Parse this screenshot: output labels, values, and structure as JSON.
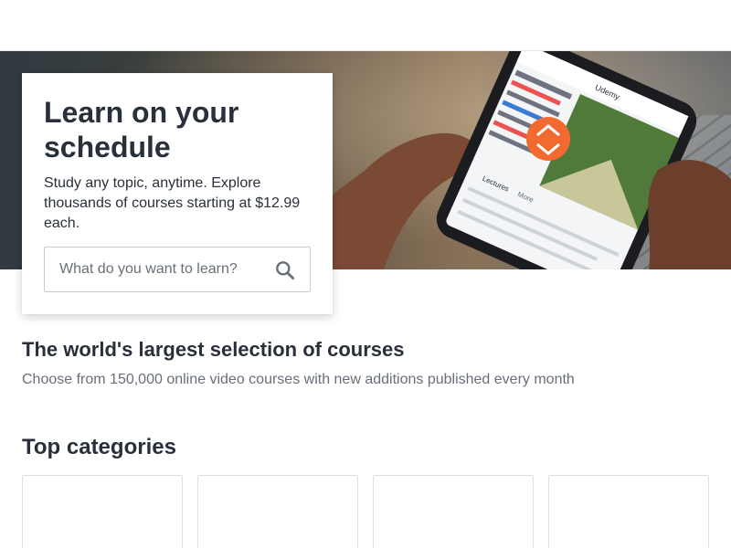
{
  "hero": {
    "title": "Learn on your schedule",
    "subtitle": "Study any topic, anytime. Explore thousands of courses starting at $12.99 each.",
    "search_placeholder": "What do you want to learn?",
    "image_icons": [
      "phone-icon",
      "udemy-logo-icon",
      "keyboard-icon"
    ],
    "phone_screen_text": {
      "brand": "Udemy",
      "tab_lectures": "Lectures",
      "tab_more": "More"
    }
  },
  "selection": {
    "title": "The world's largest selection of courses",
    "subtitle": "Choose from 150,000 online video courses with new additions published every month"
  },
  "categories": {
    "title": "Top categories",
    "items": [
      "",
      "",
      "",
      ""
    ]
  },
  "colors": {
    "text": "#29303b",
    "muted": "#686f7a",
    "brand": "#ec5252",
    "border": "#dedfe0"
  }
}
